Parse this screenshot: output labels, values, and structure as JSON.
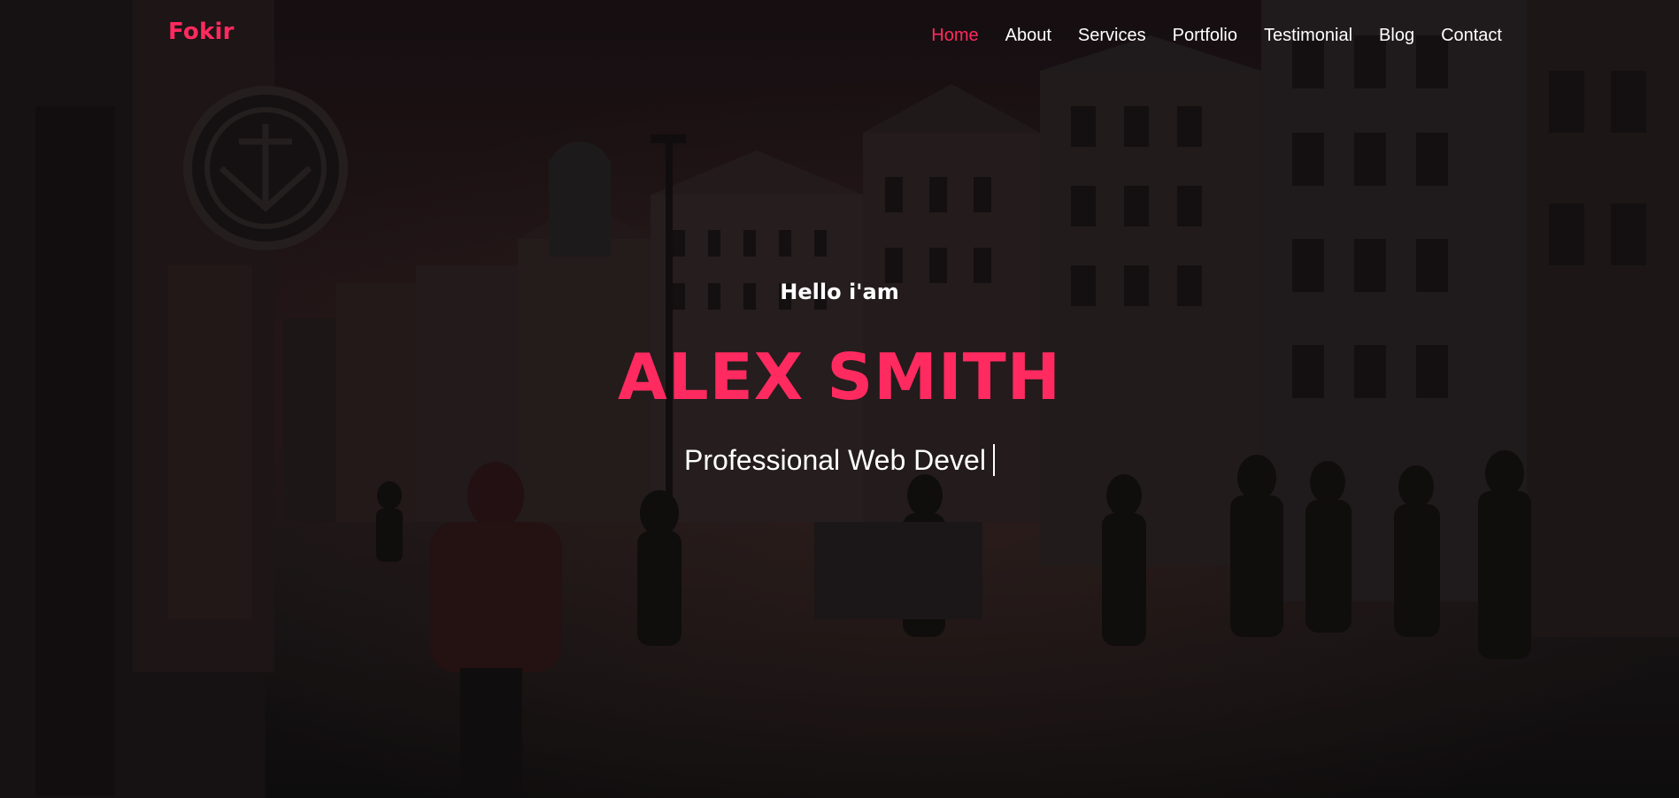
{
  "brand": {
    "name": "Fokir"
  },
  "nav": {
    "items": [
      {
        "label": "Home",
        "active": true
      },
      {
        "label": "About"
      },
      {
        "label": "Services"
      },
      {
        "label": "Portfolio"
      },
      {
        "label": "Testimonial"
      },
      {
        "label": "Blog"
      },
      {
        "label": "Contact"
      }
    ]
  },
  "hero": {
    "greeting": "Hello i'am",
    "name": "ALEX SMITH",
    "typed_text": "Professional Web Devel"
  },
  "colors": {
    "accent": "#ff2a5f",
    "text": "#ffffff",
    "background": "#141012"
  }
}
